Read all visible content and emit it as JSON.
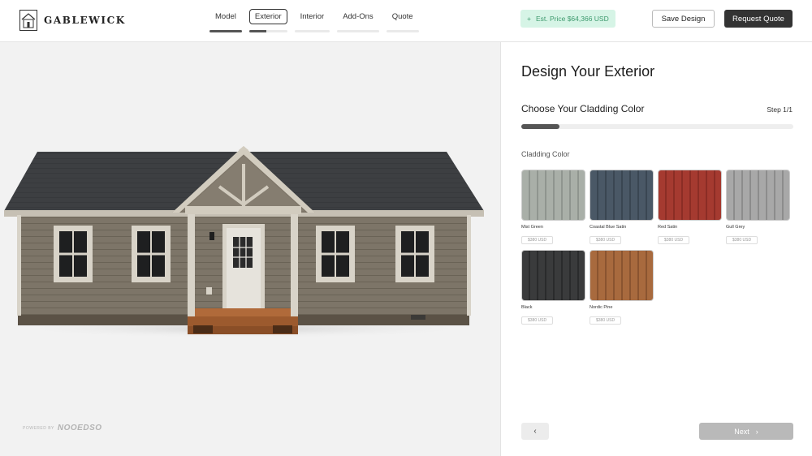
{
  "brand": {
    "name": "GABLEWICK",
    "logo_icon": "house-logo-icon"
  },
  "nav": {
    "steps": [
      {
        "label": "Model",
        "active": false,
        "progress": 1.0
      },
      {
        "label": "Exterior",
        "active": true,
        "progress": 0.45
      },
      {
        "label": "Interior",
        "active": false,
        "progress": 0
      },
      {
        "label": "Add-Ons",
        "active": false,
        "progress": 0
      },
      {
        "label": "Quote",
        "active": false,
        "progress": 0
      }
    ]
  },
  "price": {
    "icon": "plus-icon",
    "label": "Est. Price $64,366 USD"
  },
  "actions": {
    "save_label": "Save Design",
    "quote_label": "Request Quote"
  },
  "viewer": {
    "powered_by": "POWERED BY",
    "vendor": "NOOEDSO"
  },
  "panel": {
    "title": "Design Your Exterior",
    "subtitle": "Choose Your Cladding Color",
    "step_counter": "Step 1/1",
    "progress": 0.14,
    "section_label": "Cladding Color",
    "swatches": [
      {
        "name": "Mist Green",
        "price": "$380 USD",
        "color": "#a9afa8",
        "line": "#8f958f"
      },
      {
        "name": "Coastal Blue Satin",
        "price": "$380 USD",
        "color": "#4a5866",
        "line": "#3a4652"
      },
      {
        "name": "Red Satin",
        "price": "$380 USD",
        "color": "#a53a30",
        "line": "#8b2d25"
      },
      {
        "name": "Gull Grey",
        "price": "$380 USD",
        "color": "#a8a8a8",
        "line": "#8c8c8c"
      },
      {
        "name": "Black",
        "price": "$380 USD",
        "color": "#3a3b3c",
        "line": "#2a2b2c"
      },
      {
        "name": "Nordic Pine",
        "price": "$380 USD",
        "color": "#a86a3e",
        "line": "#8a5430"
      }
    ]
  },
  "footer": {
    "back_icon": "chevron-left-icon",
    "next_label": "Next",
    "next_icon": "chevron-right-icon"
  }
}
